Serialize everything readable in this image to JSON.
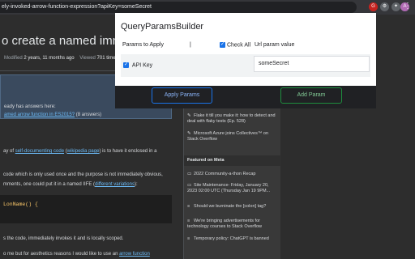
{
  "browser": {
    "url_fragment": "ely-invoked-arrow-function-expression?apiKey=someSecret",
    "ext_icon_1": "gear-icon",
    "ext_icon_2": "extensions-icon",
    "profile_initial": "A",
    "ext_badge": "G"
  },
  "page": {
    "question_title": "o create a named immediately in",
    "modified_label": "Modified",
    "modified_value": "2 years, 11 months ago",
    "viewed_label": "Viewed",
    "viewed_value": "701 times",
    "notice_line1": "eady has answers here:",
    "notice_link": "amed arrow function in ES2015?",
    "notice_count": "(8 answers)",
    "p1_prefix": "ay of",
    "p1_link1": "self-documenting code",
    "p1_link2": "wikipedia page",
    "p1_suffix": ") is to have it enclosed in a",
    "p2_line1": "code which is only used once and the purpose is not immediately obvious,",
    "p2_line2_prefix": "mments, one could put it in a named IIFE",
    "p2_link": "different variations",
    "code_text": "LonName() {",
    "p3": "s the code, immediately invokes it and is locally scoped.",
    "p4_prefix": "o me but for aesthetics reasons I would like to use an",
    "p4_link": "arrow function"
  },
  "sidebar": {
    "item1": "Flake it till you make it: how to detect and deal with flaky tests (Ep. 528)",
    "item2": "Microsoft Azure joins Collectives™ on Stack Overflow",
    "featured_head": "Featured on Meta",
    "item3": "2022 Community-a-thon Recap",
    "item4": "Site Maintenance- Friday, January 20, 2023 02:00 UTC (Thursday Jan 19 9PM...",
    "item5": "Should we burninate the [colon] tag?",
    "item6": "We're bringing advertisements for technology courses to Stack Overflow",
    "item7": "Temporary policy: ChatGPT is banned"
  },
  "popup": {
    "title": "QueryParamsBuilder",
    "col_params": "Params to Apply",
    "col_separator": "|",
    "check_all_label": "Check All",
    "col_url_value": "Url param value",
    "row_key": "API Key",
    "row_value": "someSecret",
    "apply_button": "Apply Params",
    "add_button": "Add Param"
  }
}
